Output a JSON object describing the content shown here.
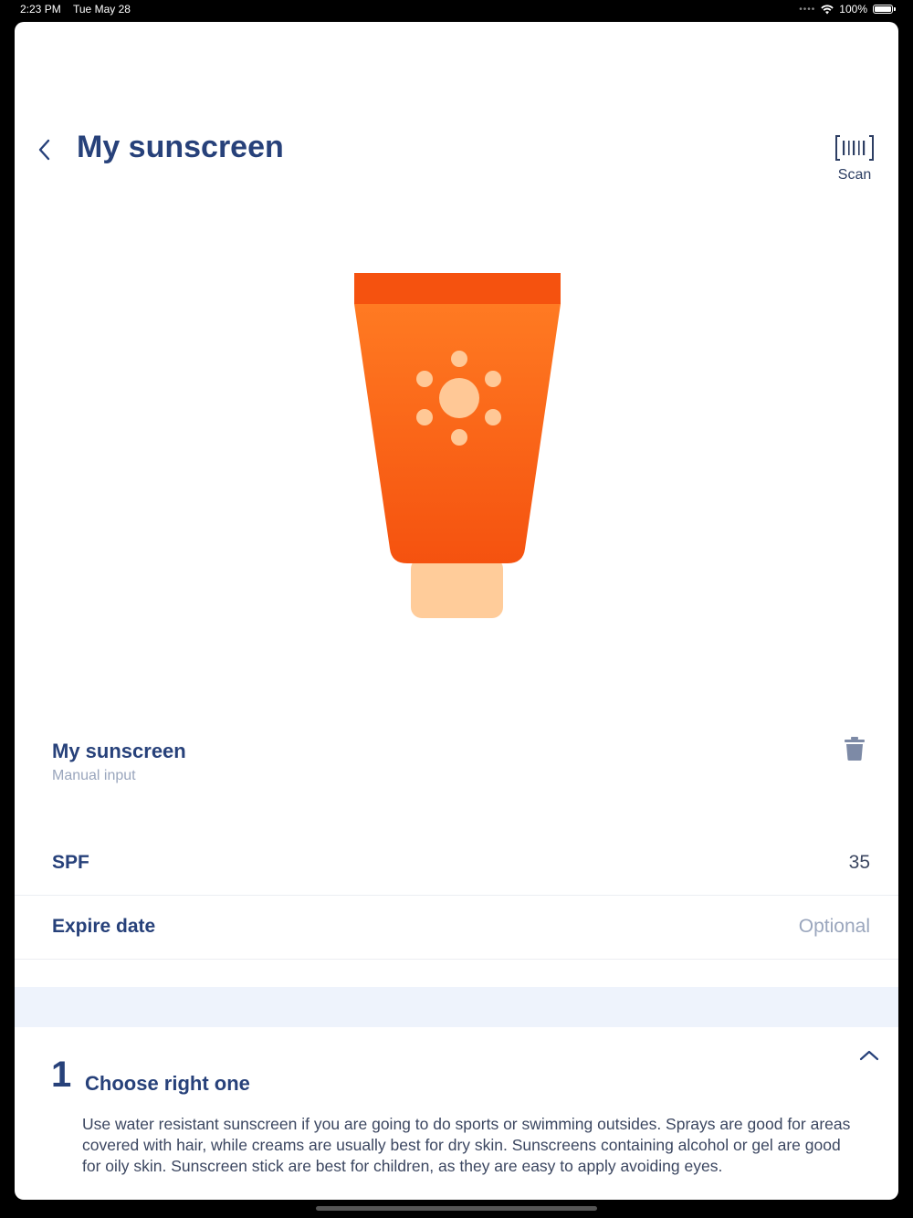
{
  "status_bar": {
    "time": "2:23 PM",
    "date": "Tue May 28",
    "battery": "100%"
  },
  "header": {
    "title": "My sunscreen",
    "back_icon": "chevron-left-icon",
    "scan_label": "Scan",
    "scan_icon": "barcode-icon"
  },
  "product": {
    "name": "My sunscreen",
    "source": "Manual input",
    "illustration_icon": "sunscreen-tube-icon",
    "delete_icon": "trash-icon",
    "colors": {
      "tube": "#fa6419",
      "cap_top": "#f5520f",
      "nozzle": "#ffcc9a",
      "sun": "#ffc896"
    }
  },
  "fields": {
    "spf": {
      "label": "SPF",
      "value": "35"
    },
    "expire": {
      "label": "Expire date",
      "placeholder": "Optional"
    }
  },
  "tip": {
    "number": "1",
    "title": "Choose right one",
    "toggle_icon": "chevron-up-icon",
    "body": "Use water resistant sunscreen if you are going to do sports or swimming outsides.  Sprays are good for areas covered with hair, while creams are usually best for dry skin. Sunscreens containing alcohol or gel are good for oily skin. Sunscreen stick are best for children, as they are easy to apply avoiding eyes."
  },
  "colors": {
    "title": "#27417a",
    "muted": "#9aa6bd",
    "section_bg": "#eef3fc"
  }
}
